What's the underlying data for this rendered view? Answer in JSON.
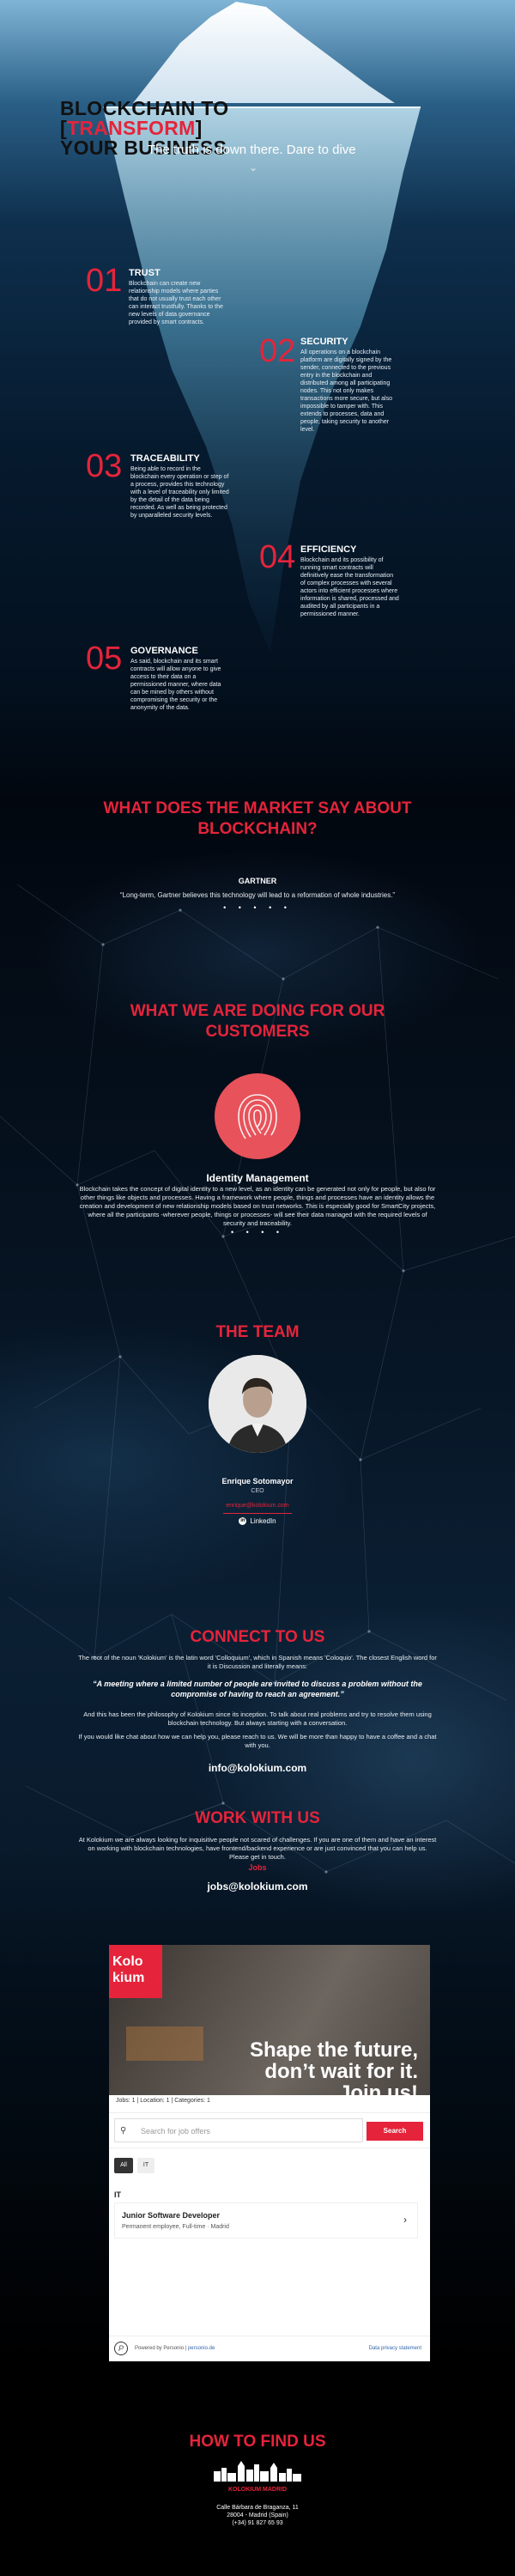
{
  "hero": {
    "title_line1": "BLOCKCHAIN TO",
    "title_bracket_open": "[",
    "title_highlight": "TRANSFORM",
    "title_bracket_close": "]",
    "title_line3": "YOUR BUSINESS",
    "subtitle": "The truth is down there. Dare to dive"
  },
  "features": [
    {
      "num": "01",
      "title": "TRUST",
      "desc": "Blockchain can create new relationship models where parties that do not usually trust each other can interact trustfully. Thanks to the new levels of data governance provided by smart contracts."
    },
    {
      "num": "02",
      "title": "SECURITY",
      "desc": "All operations on a blockchain platform are digitally signed by the sender, connected to the previous entry in the blockchain and distributed among all participating nodes. This not only makes transactions more secure, but also impossible to tamper with. This extends to processes, data and people, taking security to another level."
    },
    {
      "num": "03",
      "title": "TRACEABILITY",
      "desc": "Being able to record in the blockchain every operation or step of a process, provides this technology with a level of traceability only limited by the detail of the data being recorded. As well as being protected by unparalleled security levels."
    },
    {
      "num": "04",
      "title": "EFFICIENCY",
      "desc": "Blockchain and its possibility of running smart contracts will definitively ease the transformation of complex processes with several actors into efficient processes where information is shared, processed and audited by all participants in a permissioned manner."
    },
    {
      "num": "05",
      "title": "GOVERNANCE",
      "desc": "As said, blockchain and its smart contracts will allow anyone to give access to their data on a permissioned manner, where data can be mined by others without compromising the security or the anonymity of the data."
    }
  ],
  "market": {
    "title": "WHAT DOES THE MARKET SAY ABOUT BLOCKCHAIN?",
    "source": "GARTNER",
    "quote": "“Long-term, Gartner believes this technology will lead to a reformation of whole industries.”",
    "dots": "• • • • •"
  },
  "doing": {
    "title": "WHAT WE ARE DOING FOR OUR CUSTOMERS",
    "item_title": "Identity Management",
    "item_desc": "Blockchain takes the concept of digital identity to a new level, as an identity can be generated not only for people, but also for other things like objects and processes. Having a framework where people, things and processes have an identity allows the creation and development of new relationship models based on trust networks. This is especially good for SmartCity projects, where all the participants -wherever people, things or processes- will see their data managed with the required levels of security and traceability.",
    "dots": "• • • •"
  },
  "team": {
    "title": "THE TEAM",
    "name": "Enrique Sotomayor",
    "role": "CEO",
    "email": "enrique@kolokium.com",
    "linkedin": "LinkedIn"
  },
  "connect": {
    "title": "CONNECT TO US",
    "p1": "The root of the noun 'Kolokium' is the latin word 'Colloquium', which in Spanish means 'Coloquio'. The closest English word for it is Discussion and literally means:",
    "quote": "“A meeting where a limited number of people are invited to discuss a problem without the compromise of having to reach an agreement.”",
    "p2": "And this has been the philosophy of Kolokium since its inception. To talk about real problems and try to resolve them using blockchain technology. But always starting with a conversation.",
    "p3": "If you would like chat about how we can help you, please reach to us. We will be more than happy to have a coffee and a chat with you.",
    "email": "info@kolokium.com"
  },
  "work": {
    "title": "WORK WITH US",
    "text": "At Kolokium we are always looking for inquisitive people not scared of challenges. If you are one of them and have an interest on working with blockchain technologies, have frontend/backend experience or are just convinced that you can help us. Please get in touch.",
    "jobs_link": "Jobs",
    "email": "jobs@kolokium.com"
  },
  "widget": {
    "logo_line1": "Kolo",
    "logo_line2": "kium",
    "headline_1": "Shape the future,",
    "headline_2": "don’t wait for it.",
    "headline_3": "Join us!",
    "filters": "Jobs: 1  |  Location: 1  |  Categories: 1",
    "search_placeholder": "Search for job offers",
    "search_button": "Search",
    "chip_all": "All",
    "chip_it": "IT",
    "category": "IT",
    "job_title": "Junior Software Developer",
    "job_meta": "Permanent employee, Full-time  ·  Madrid",
    "powered_by": "Powered by Personio",
    "personio_link": "personio.de",
    "privacy": "Data privacy statement"
  },
  "find": {
    "title": "HOW TO FIND US",
    "name": "KOLOKIUM MADRID",
    "addr1": "Calle Bárbara de Braganza, 11",
    "addr2": "28004 - Madrid (Spain)",
    "phone": "(+34) 91 827 65 93"
  },
  "colors": {
    "accent": "#e5243b",
    "background": "#000000"
  }
}
